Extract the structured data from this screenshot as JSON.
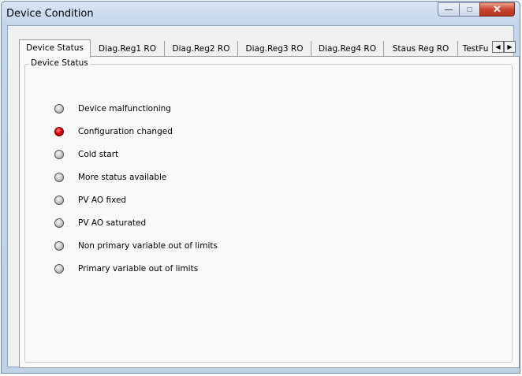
{
  "window": {
    "title": "Device Condition",
    "minimize_glyph": "—",
    "maximize_glyph": "□",
    "close_glyph": "✕"
  },
  "tabs": [
    {
      "label": "Device Status",
      "active": true
    },
    {
      "label": "Diag.Reg1 RO",
      "active": false
    },
    {
      "label": "Diag.Reg2 RO",
      "active": false
    },
    {
      "label": "Diag.Reg3 RO",
      "active": false
    },
    {
      "label": "Diag.Reg4 RO",
      "active": false
    },
    {
      "label": "Staus Reg RO",
      "active": false
    },
    {
      "label": "TestFu",
      "active": false
    }
  ],
  "tab_scroll": {
    "left_icon": "◀",
    "right_icon": "▶"
  },
  "group": {
    "title": "Device Status"
  },
  "status_items": [
    {
      "label": "Device malfunctioning",
      "on": false
    },
    {
      "label": "Configuration changed",
      "on": true
    },
    {
      "label": "Cold start",
      "on": false
    },
    {
      "label": "More status available",
      "on": false
    },
    {
      "label": "PV AO fixed",
      "on": false
    },
    {
      "label": "PV AO saturated",
      "on": false
    },
    {
      "label": "Non primary variable out of limits",
      "on": false
    },
    {
      "label": "Primary variable out of limits",
      "on": false
    }
  ],
  "colors": {
    "indicator_on": "#e00000",
    "indicator_off": "#bdbdbd"
  }
}
